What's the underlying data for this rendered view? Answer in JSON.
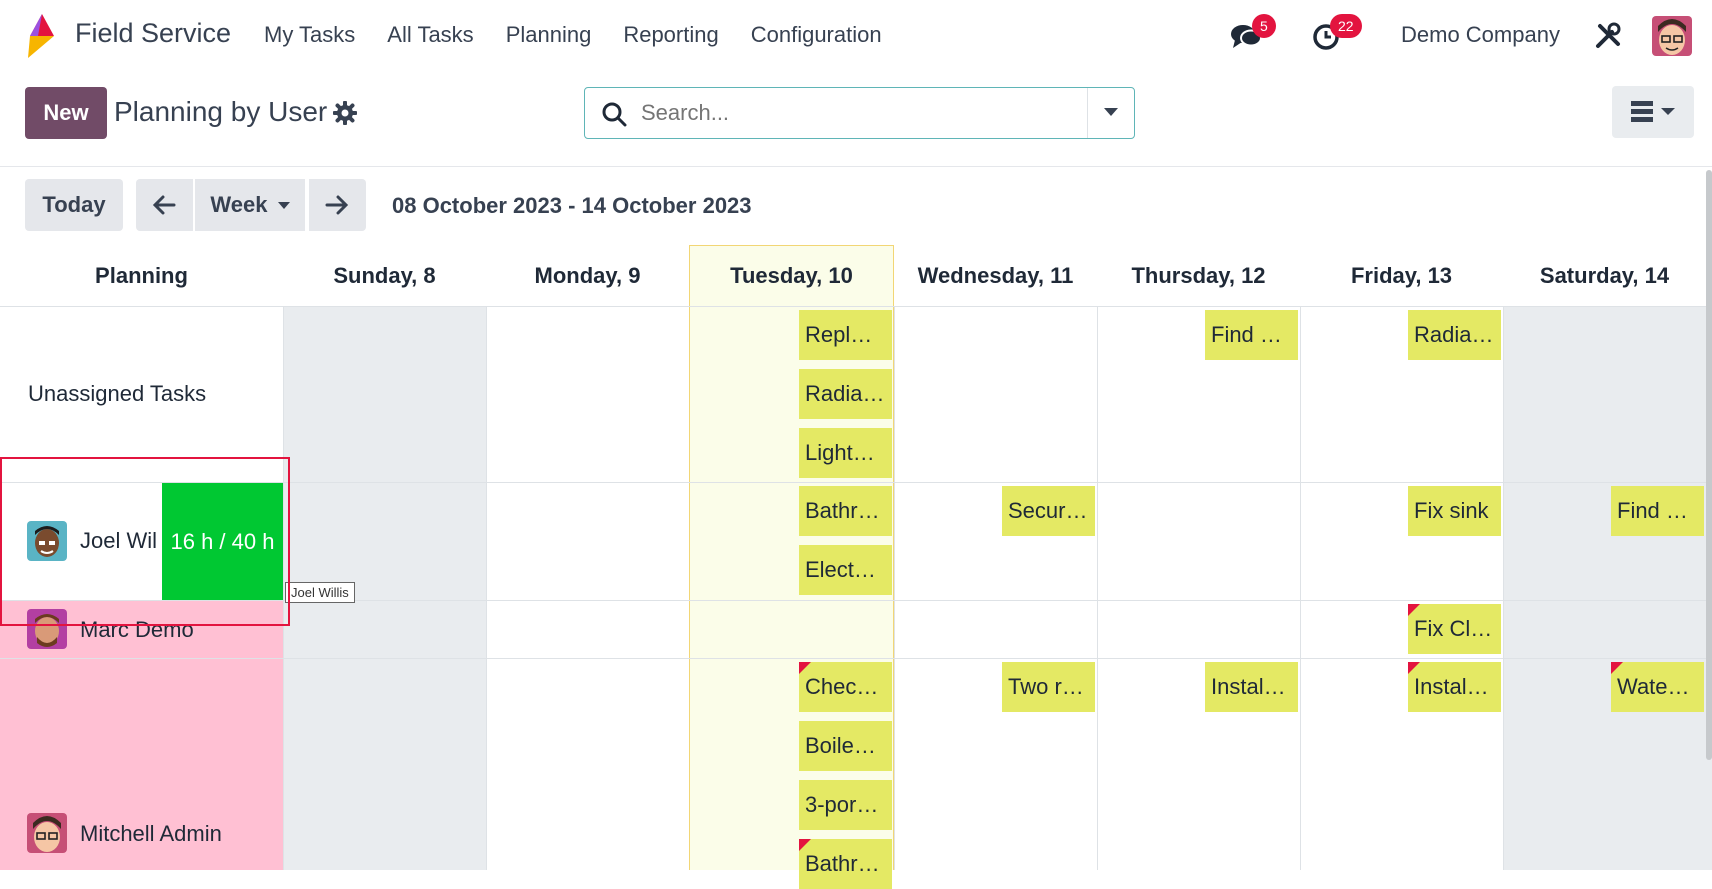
{
  "navbar": {
    "app_name": "Field Service",
    "menu": [
      "My Tasks",
      "All Tasks",
      "Planning",
      "Reporting",
      "Configuration"
    ],
    "messages_count": "5",
    "activities_count": "22",
    "company": "Demo Company"
  },
  "control_panel": {
    "new_label": "New",
    "title": "Planning by User",
    "search_placeholder": "Search..."
  },
  "calendar": {
    "today_label": "Today",
    "scale_label": "Week",
    "date_range": "08 October 2023 - 14 October 2023",
    "row_header": "Planning",
    "days": [
      "Sunday, 8",
      "Monday, 9",
      "Tuesday, 10",
      "Wednesday, 11",
      "Thursday, 12",
      "Friday, 13",
      "Saturday, 14"
    ],
    "rows": [
      {
        "label": "Unassigned Tasks",
        "tasks": [
          {
            "day": 2,
            "slot": 0,
            "text": "Repl…",
            "flag": false
          },
          {
            "day": 2,
            "slot": 1,
            "text": "Radia…",
            "flag": false
          },
          {
            "day": 2,
            "slot": 2,
            "text": "Light…",
            "flag": false
          },
          {
            "day": 4,
            "slot": 0,
            "text": "Find …",
            "flag": false
          },
          {
            "day": 5,
            "slot": 0,
            "text": "Radia…",
            "flag": false
          }
        ]
      },
      {
        "label": "Joel Wil",
        "workload": "16 h / 40 h",
        "tooltip": "Joel Willis",
        "tasks": [
          {
            "day": 2,
            "slot": 0,
            "text": "Bathr…",
            "flag": false
          },
          {
            "day": 2,
            "slot": 1,
            "text": "Elect…",
            "flag": false
          },
          {
            "day": 3,
            "slot": 0,
            "text": "Secur…",
            "flag": false
          },
          {
            "day": 5,
            "slot": 0,
            "text": "Fix sink",
            "flag": false
          },
          {
            "day": 6,
            "slot": 0,
            "text": "Find …",
            "flag": false
          }
        ]
      },
      {
        "label": "Marc Demo",
        "tasks": [
          {
            "day": 5,
            "slot": 0,
            "text": "Fix Cl…",
            "flag": true
          }
        ]
      },
      {
        "label": "Mitchell Admin",
        "tasks": [
          {
            "day": 2,
            "slot": 0,
            "text": "Chec…",
            "flag": true
          },
          {
            "day": 2,
            "slot": 1,
            "text": "Boile…",
            "flag": false
          },
          {
            "day": 2,
            "slot": 2,
            "text": "3-por…",
            "flag": false
          },
          {
            "day": 2,
            "slot": 3,
            "text": "Bathr…",
            "flag": true
          },
          {
            "day": 3,
            "slot": 0,
            "text": "Two r…",
            "flag": false
          },
          {
            "day": 4,
            "slot": 0,
            "text": "Instal…",
            "flag": false
          },
          {
            "day": 5,
            "slot": 0,
            "text": "Instal…",
            "flag": true
          },
          {
            "day": 6,
            "slot": 0,
            "text": "Wate…",
            "flag": true
          }
        ]
      }
    ]
  },
  "colors": {
    "brand": "#714b67",
    "task": "#e4e964",
    "today_column": "#fbfde9",
    "weekend": "#e9ecef",
    "overload_row": "#ffc0d3",
    "workload_ok": "#00c832",
    "badge": "#e3143f"
  }
}
